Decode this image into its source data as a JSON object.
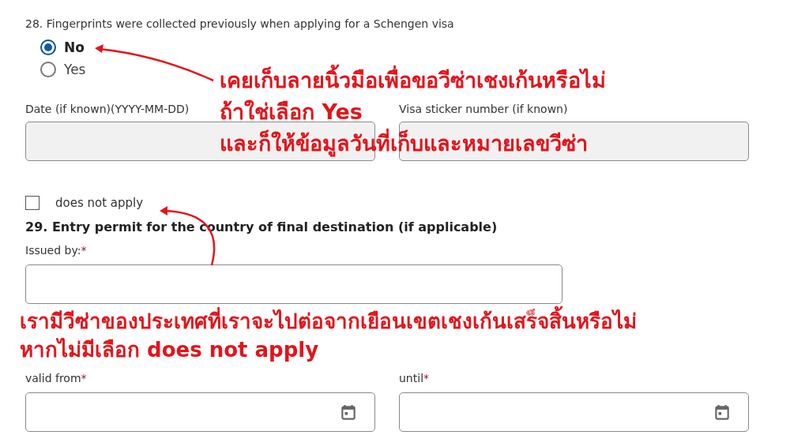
{
  "question_28": {
    "label": "28. Fingerprints were collected previously when applying for a Schengen visa",
    "options": [
      {
        "label": "No",
        "selected": true
      },
      {
        "label": "Yes",
        "selected": false
      }
    ],
    "fields": [
      {
        "label": "Date (if known)(YYYY-MM-DD)",
        "disabled": true
      },
      {
        "label": "Visa sticker number (if known)",
        "disabled": true
      }
    ]
  },
  "does_not_apply": {
    "label": "does not apply",
    "checked": false
  },
  "question_29": {
    "title": "29. Entry permit for the country of final destination (if applicable)",
    "issued_by": {
      "label": "Issued by:",
      "mark": "*"
    },
    "dates": [
      {
        "label": "valid from",
        "mark": "*"
      },
      {
        "label": "until",
        "mark": "*"
      }
    ]
  },
  "annotations": [
    {
      "lines": [
        "เคยเก็บลายนิ้วมือเพื่อขอวีซ่าเชงเก้นหรือไม่",
        "ถ้าใช่เลือก Yes",
        "และก็ให้ข้อมูลวันที่เก็บและหมายเลขวีซ่า"
      ]
    },
    {
      "lines": [
        "เรามีวีซ่าของประเทศที่เราจะไปต่อจากเยือนเขตเชงเก้นเสร็จสิ้นหรือไม่",
        "หากไม่มีเลือก does not apply"
      ]
    }
  ]
}
